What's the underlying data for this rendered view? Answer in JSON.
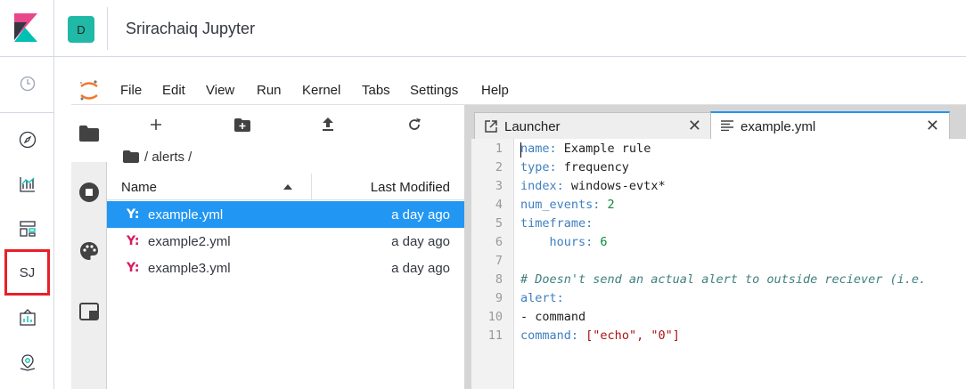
{
  "app": {
    "header_title": "Srirachaiq Jupyter",
    "avatar_letter": "D"
  },
  "kibana_nav": {
    "active_item_label": "SJ"
  },
  "menubar": [
    "File",
    "Edit",
    "View",
    "Run",
    "Kernel",
    "Tabs",
    "Settings",
    "Help"
  ],
  "filebrowser": {
    "breadcrumb": "/ alerts /",
    "col_name": "Name",
    "col_modified": "Last Modified",
    "files": [
      {
        "icon": "Y:",
        "name": "example.yml",
        "modified": "a day ago",
        "selected": true
      },
      {
        "icon": "Y:",
        "name": "example2.yml",
        "modified": "a day ago",
        "selected": false
      },
      {
        "icon": "Y:",
        "name": "example3.yml",
        "modified": "a day ago",
        "selected": false
      }
    ]
  },
  "tabs": [
    {
      "label": "Launcher",
      "active": false
    },
    {
      "label": "example.yml",
      "active": true
    }
  ],
  "editor": {
    "line_numbers": [
      "1",
      "2",
      "3",
      "4",
      "5",
      "6",
      "7",
      "8",
      "9",
      "10",
      "11"
    ],
    "lines": [
      {
        "key": "name",
        "value": " Example rule"
      },
      {
        "key": "type",
        "value": " frequency"
      },
      {
        "key": "index",
        "value": " windows-evtx*"
      },
      {
        "key": "num_events",
        "number": " 2"
      },
      {
        "key": "timeframe",
        "value": ""
      },
      {
        "indent_key": "    hours",
        "number": " 6"
      },
      {
        "blank": ""
      },
      {
        "comment": "# Doesn't send an actual alert to outside reciever (i.e."
      },
      {
        "key": "alert",
        "value": ""
      },
      {
        "plain": "- command"
      },
      {
        "key": "command",
        "list": " [\"echo\", \"0\"]"
      }
    ]
  },
  "colors": {
    "accent": "#2196f3",
    "highlight_border": "#e7202a",
    "avatar_bg": "#20b8a6"
  }
}
